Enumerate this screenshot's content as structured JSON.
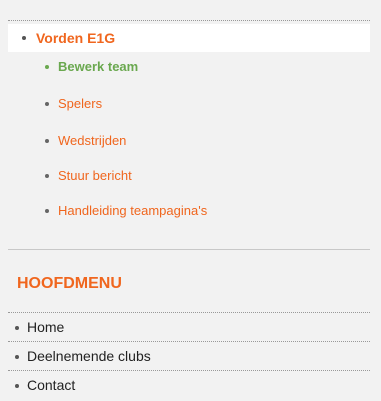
{
  "team_menu": {
    "team_name": "Vorden E1G",
    "items": [
      {
        "label": "Bewerk team",
        "active": true
      },
      {
        "label": "Spelers",
        "active": false
      },
      {
        "label": "Wedstrijden",
        "active": false
      },
      {
        "label": "Stuur bericht",
        "active": false
      },
      {
        "label": "Handleiding teampagina's",
        "active": false
      }
    ]
  },
  "main_menu": {
    "title": "HOOFDMENU",
    "items": [
      {
        "label": "Home"
      },
      {
        "label": "Deelnemende clubs"
      },
      {
        "label": "Contact"
      }
    ]
  },
  "colors": {
    "accent": "#f0661e",
    "active": "#6aa84f",
    "background": "#f2f2f2",
    "text": "#222222"
  }
}
